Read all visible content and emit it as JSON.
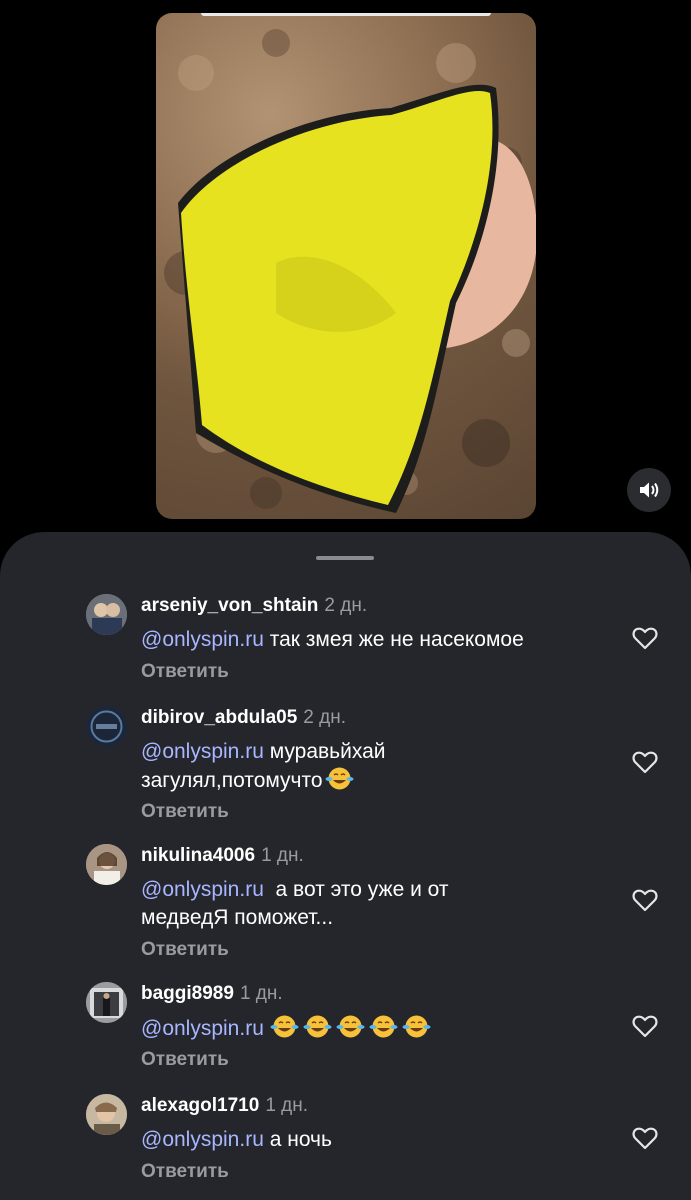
{
  "video": {
    "mute_icon": "speaker-muted-icon"
  },
  "comments": [
    {
      "username": "arseniy_von_shtain",
      "time": "2 дн.",
      "mention": "@onlyspin.ru",
      "text": " так змея же не насекомое",
      "reply_label": "Ответить",
      "avatar_color": "#8c8f97"
    },
    {
      "username": "dibirov_abdula05",
      "time": "2 дн.",
      "mention": "@onlyspin.ru",
      "text": " муравьйхай загулял,потомучто",
      "reply_label": "Ответить",
      "avatar_color": "#24344a"
    },
    {
      "username": "nikulina4006",
      "time": "1 дн.",
      "mention": "@onlyspin.ru",
      "text": "  а вот это уже и от медведЯ поможет...",
      "reply_label": "Ответить",
      "avatar_color": "#b9a08a"
    },
    {
      "username": "baggi8989",
      "time": "1 дн.",
      "mention": "@onlyspin.ru",
      "text": " ",
      "reply_label": "Ответить",
      "avatar_color": "#7e7f82"
    },
    {
      "username": "alexagol1710",
      "time": "1 дн.",
      "mention": "@onlyspin.ru",
      "text": " а ночь",
      "reply_label": "Ответить",
      "avatar_color": "#b5a48e"
    }
  ],
  "icons": {
    "like": "heart-outline-icon",
    "emoji": "face-with-tears-of-joy-icon"
  },
  "colors": {
    "mention": "#a7b6ff",
    "sheet_bg": "#25262b",
    "secondary_text": "#9a9ba0"
  }
}
